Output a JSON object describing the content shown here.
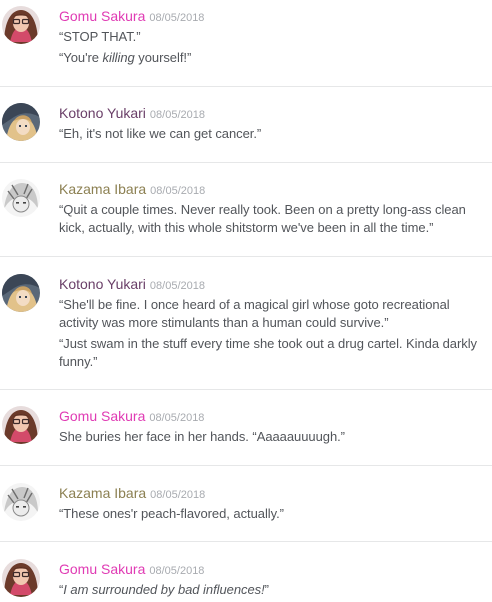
{
  "colors": {
    "gomu": "#e03bb4",
    "kotono": "#6a3f68",
    "kazama": "#8c8052"
  },
  "messages": [
    {
      "author": "Gomu Sakura",
      "timestamp": "08/05/2018",
      "avatar": "gomu-avatar",
      "lines": [
        {
          "pre": "“STOP THAT.”",
          "em": "",
          "post": ""
        },
        {
          "pre": "“You're ",
          "em": "killing",
          "post": " yourself!”"
        }
      ]
    },
    {
      "author": "Kotono Yukari",
      "timestamp": "08/05/2018",
      "avatar": "kotono-avatar",
      "lines": [
        {
          "pre": "“Eh, it's not like we can get cancer.”",
          "em": "",
          "post": ""
        }
      ]
    },
    {
      "author": "Kazama Ibara",
      "timestamp": "08/05/2018",
      "avatar": "kazama-avatar",
      "lines": [
        {
          "pre": "“Quit a couple times. Never really took. Been on a pretty long-ass clean kick, actually, with this whole shitstorm we've been in all the time.”",
          "em": "",
          "post": ""
        }
      ]
    },
    {
      "author": "Kotono Yukari",
      "timestamp": "08/05/2018",
      "avatar": "kotono-avatar",
      "lines": [
        {
          "pre": "“She'll be fine. I once heard of a magical girl whose goto recreational activity was more stimulants than a human could survive.”",
          "em": "",
          "post": ""
        },
        {
          "pre": "“Just swam in the stuff every time she took out a drug cartel. Kinda darkly funny.”",
          "em": "",
          "post": ""
        }
      ]
    },
    {
      "author": "Gomu Sakura",
      "timestamp": "08/05/2018",
      "avatar": "gomu-avatar",
      "lines": [
        {
          "pre": "She buries her face in her hands. “Aaaaauuuugh.”",
          "em": "",
          "post": ""
        }
      ]
    },
    {
      "author": "Kazama Ibara",
      "timestamp": "08/05/2018",
      "avatar": "kazama-avatar",
      "lines": [
        {
          "pre": "“These ones'r peach-flavored, actually.”",
          "em": "",
          "post": ""
        }
      ]
    },
    {
      "author": "Gomu Sakura",
      "timestamp": "08/05/2018",
      "avatar": "gomu-avatar",
      "lines": [
        {
          "pre": "“",
          "em": "I am surrounded by bad influences!",
          "post": "”"
        }
      ]
    }
  ]
}
